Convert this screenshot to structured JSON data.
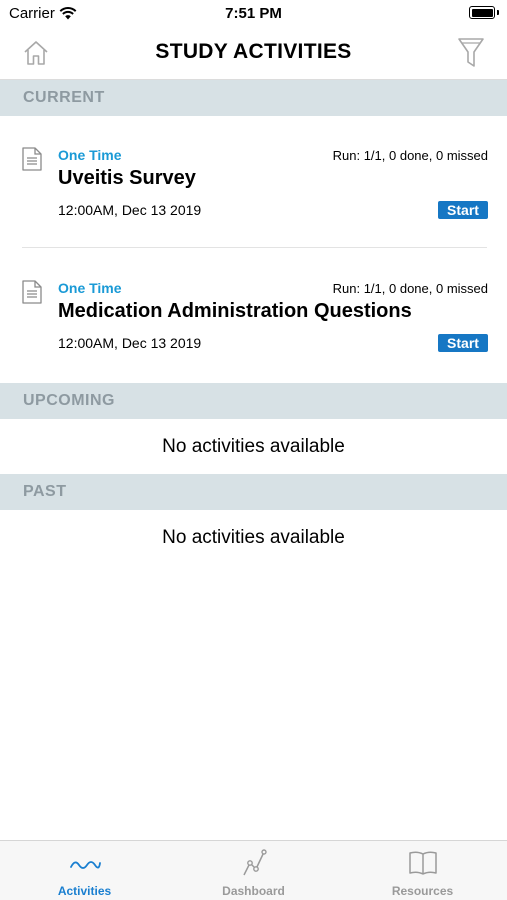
{
  "status_bar": {
    "carrier": "Carrier",
    "time": "7:51 PM"
  },
  "nav": {
    "title": "STUDY ACTIVITIES",
    "left_icon": "home-icon",
    "right_icon": "filter-icon"
  },
  "sections": {
    "current": {
      "header": "CURRENT",
      "activities": [
        {
          "frequency": "One Time",
          "run": "Run: 1/1, 0 done, 0 missed",
          "title": "Uveitis Survey",
          "date": "12:00AM, Dec 13 2019",
          "action": "Start"
        },
        {
          "frequency": "One Time",
          "run": "Run: 1/1, 0 done, 0 missed",
          "title": "Medication Administration Questions",
          "date": "12:00AM, Dec 13 2019",
          "action": "Start"
        }
      ]
    },
    "upcoming": {
      "header": "UPCOMING",
      "empty": "No activities available"
    },
    "past": {
      "header": "PAST",
      "empty": "No activities available"
    }
  },
  "tab_bar": {
    "tabs": [
      {
        "label": "Activities",
        "icon": "activities-wave-icon",
        "active": true
      },
      {
        "label": "Dashboard",
        "icon": "dashboard-chart-icon",
        "active": false
      },
      {
        "label": "Resources",
        "icon": "resources-book-icon",
        "active": false
      }
    ]
  },
  "colors": {
    "accent": "#1a9ad6",
    "button": "#1677c4",
    "section_header_bg": "#d7e1e5",
    "section_header_text": "#8e9aa1",
    "tab_active": "#1a7fd0",
    "tab_inactive": "#9a9a9a"
  }
}
